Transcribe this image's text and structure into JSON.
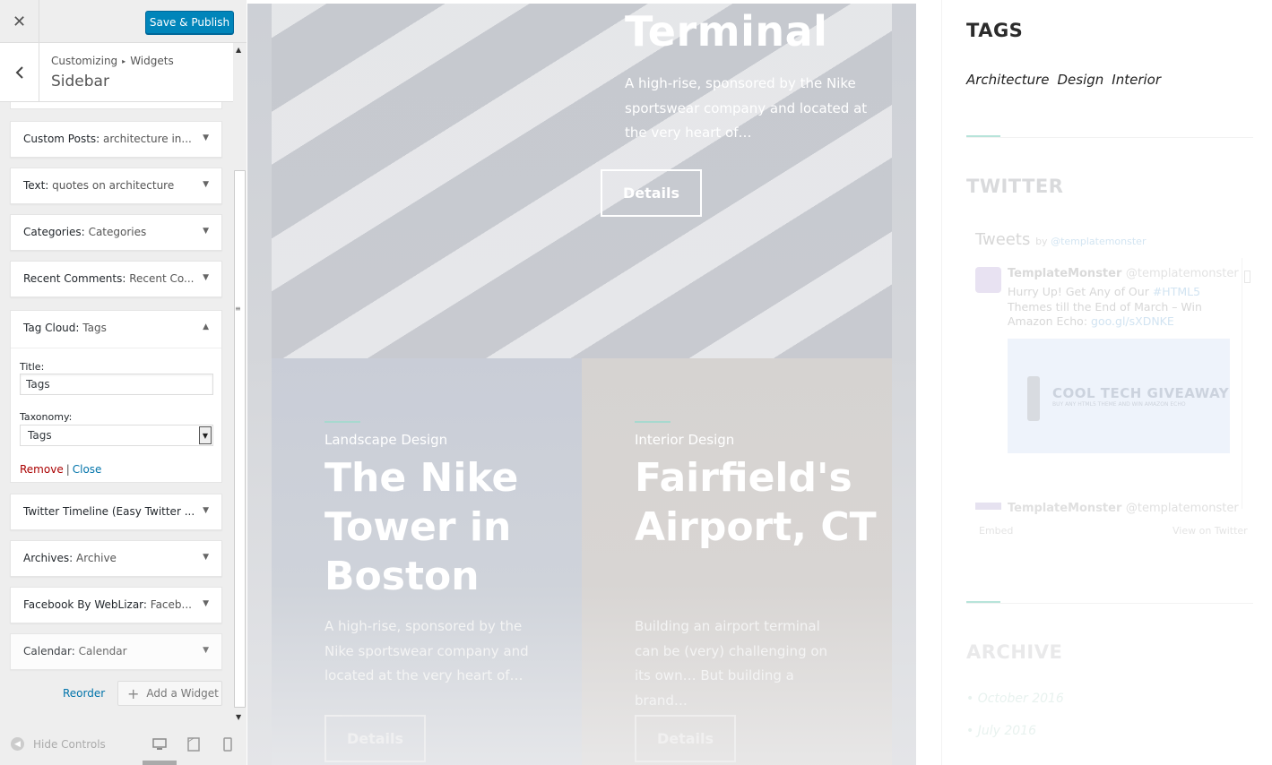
{
  "customizer": {
    "close_icon": "close-icon",
    "publish_label": "Save & Publish",
    "breadcrumb_root": "Customizing",
    "breadcrumb_sep": "▸",
    "breadcrumb_section": "Widgets",
    "section_title": "Sidebar",
    "widgets": [
      {
        "type": "Custom Posts:",
        "title": "architecture in..."
      },
      {
        "type": "Text:",
        "title": "quotes on architecture"
      },
      {
        "type": "Categories:",
        "title": "Categories"
      },
      {
        "type": "Recent Comments:",
        "title": "Recent Co..."
      },
      {
        "type": "Tag Cloud:",
        "title": "Tags"
      },
      {
        "type": "Twitter Timeline (Easy Twitter ...",
        "title": ""
      },
      {
        "type": "Archives:",
        "title": "Archive"
      },
      {
        "type": "Facebook By WebLizar:",
        "title": "Faceb..."
      },
      {
        "type": "Calendar:",
        "title": "Calendar"
      }
    ],
    "tag_cloud_form": {
      "title_label": "Title:",
      "title_value": "Tags",
      "taxonomy_label": "Taxonomy:",
      "taxonomy_value": "Tags",
      "remove_label": "Remove",
      "separator": "|",
      "close_label": "Close"
    },
    "reorder_label": "Reorder",
    "add_widget_label": "Add a Widget",
    "hide_controls_label": "Hide Controls",
    "devices": [
      "desktop-icon",
      "tablet-icon",
      "mobile-icon"
    ]
  },
  "preview": {
    "hero": {
      "title": "Terminal",
      "description": "A high-rise, sponsored by the Nike sportswear company and located at the very heart of…",
      "button": "Details"
    },
    "cards": [
      {
        "category": "Landscape Design",
        "title": "The Nike Tower in Boston",
        "description": "A high-rise, sponsored by the Nike sportswear company and located at the very heart of…",
        "button": "Details"
      },
      {
        "category": "Interior Design",
        "title": "Fairfield's Airport, CT",
        "description": "Building an airport terminal can be (very) challenging on its own… But building a brand…",
        "button": "Details"
      }
    ],
    "sidebar": {
      "tags_title": "TAGS",
      "tags": [
        "Architecture",
        "Design",
        "Interior"
      ],
      "twitter_title": "TWITTER",
      "twitter": {
        "header": "Tweets",
        "by": "by",
        "by_handle": "@templatemonster",
        "author_name": "TemplateMonster",
        "author_handle": "@templatemonster",
        "tweet_text_1": "Hurry Up! Get Any of Our",
        "tweet_hashtag": "#HTML5",
        "tweet_text_2": "Themes till the End of March – Win Amazon Echo:",
        "tweet_link": "goo.gl/sXDNKE",
        "card_title": "COOL TECH GIVEAWAY",
        "card_subtitle": "BUY ANY HTML5 THEME AND WIN AMAZON ECHO",
        "second_author": "TemplateMonster",
        "second_handle": "@templatemonster",
        "embed_label": "Embed",
        "view_label": "View on Twitter"
      },
      "archive_title": "ARCHIVE",
      "archive_items": [
        "October 2016",
        "July 2016"
      ]
    }
  }
}
